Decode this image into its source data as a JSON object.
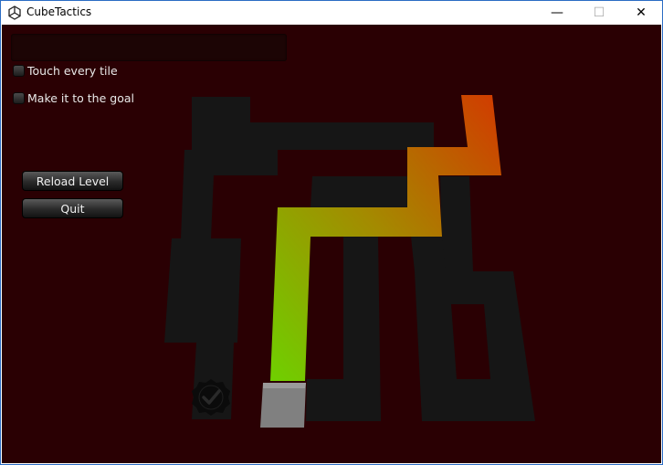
{
  "window": {
    "title": "CubeTactics",
    "minimize_glyph": "—",
    "maximize_glyph": "☐",
    "close_glyph": "✕"
  },
  "hud": {
    "objectives": [
      {
        "label": "Touch every tile",
        "checked": false
      },
      {
        "label": "Make it to the goal",
        "checked": false
      }
    ],
    "buttons": {
      "reload": "Reload Level",
      "quit": "Quit"
    }
  },
  "colors": {
    "background": "#2a0003",
    "tile": "#161616",
    "path_start": "#6fd000",
    "path_mid": "#b08a00",
    "path_end": "#d23a00",
    "player_cube": "#808080"
  },
  "icons": {
    "app": "unity-icon",
    "goal": "checkmark-badge-icon"
  }
}
